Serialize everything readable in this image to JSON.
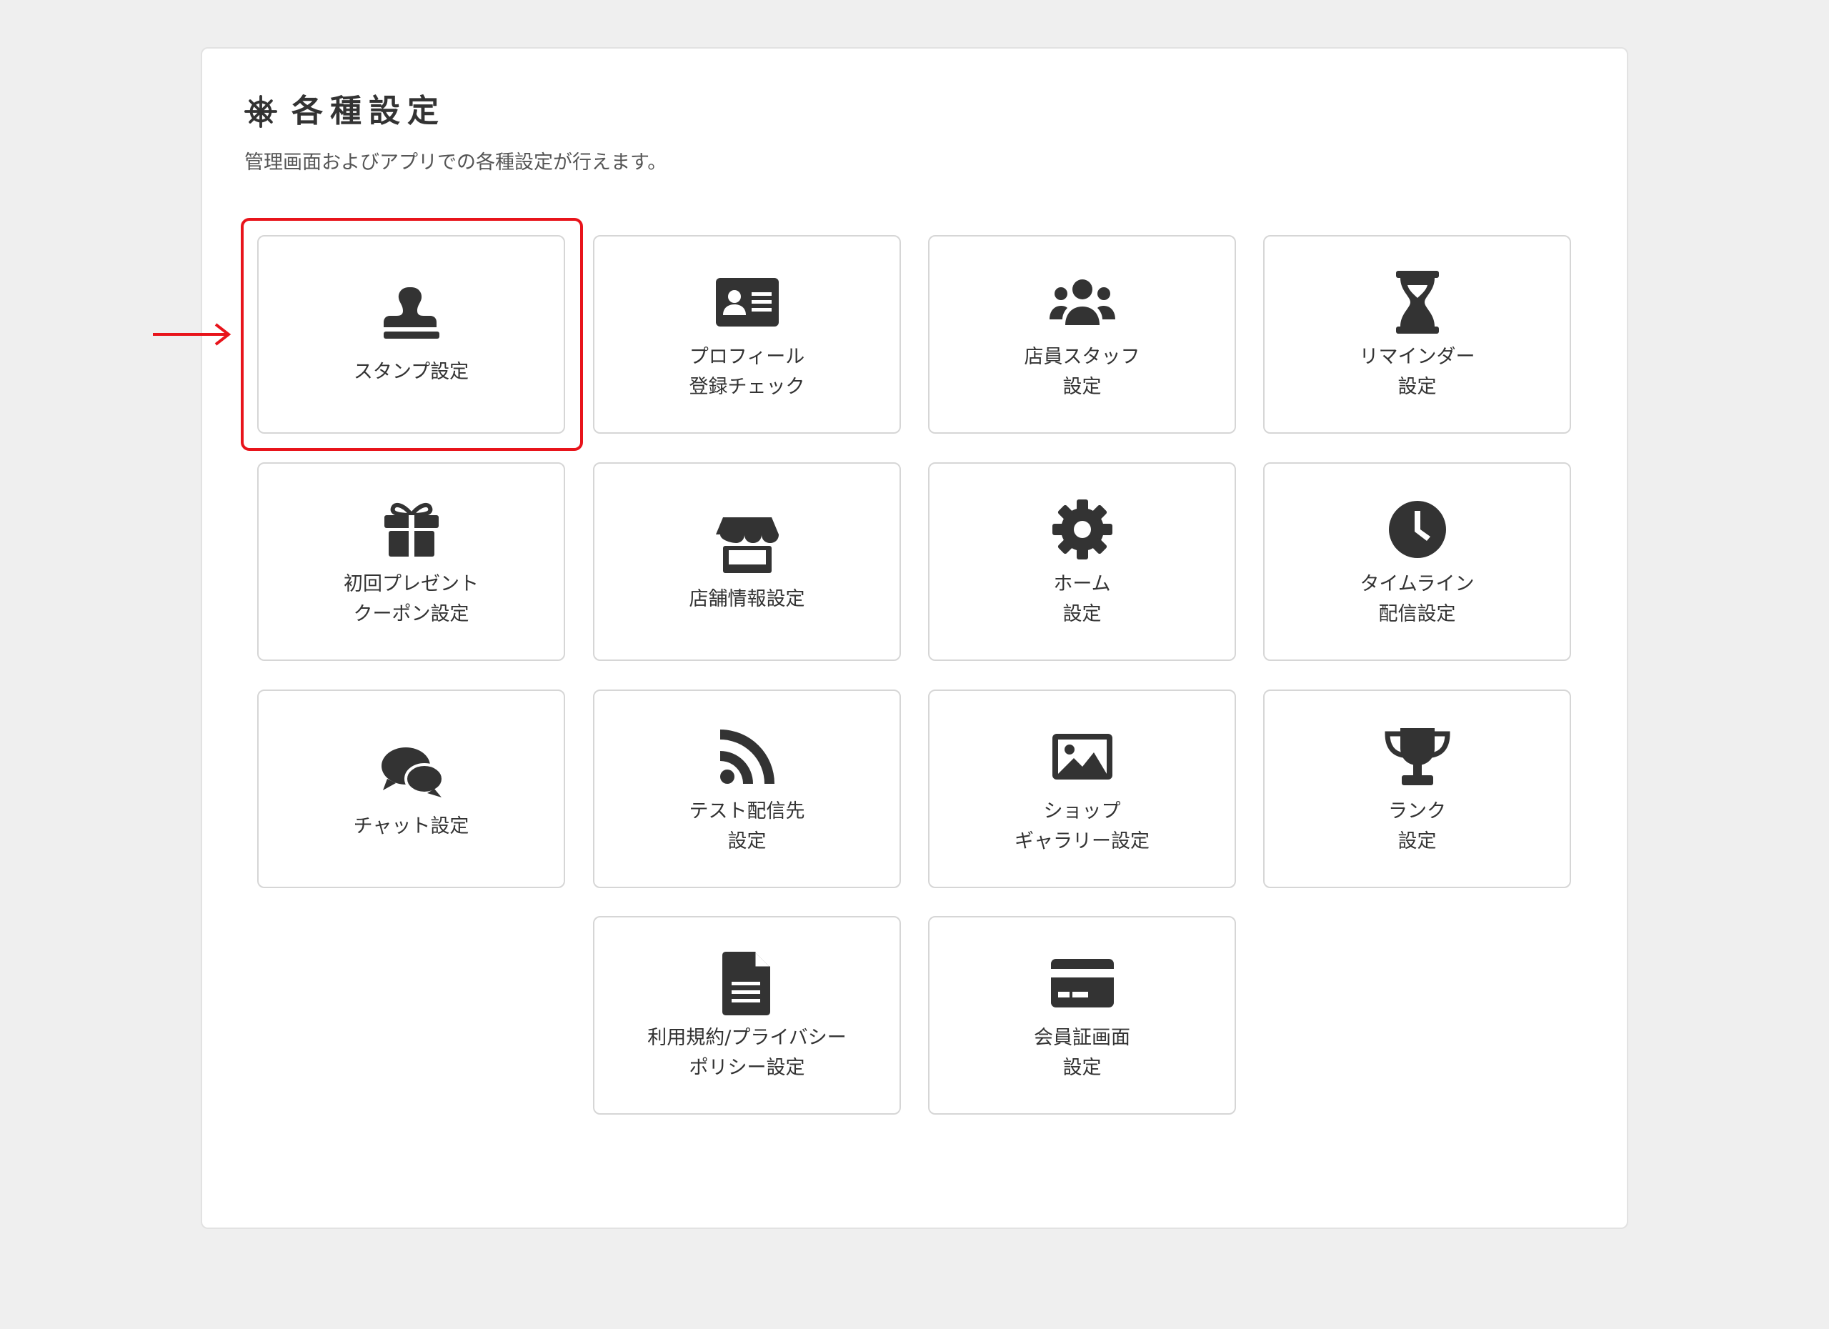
{
  "header": {
    "title": "各種設定",
    "subtitle": "管理画面およびアプリでの各種設定が行えます。"
  },
  "cards": [
    {
      "label": "スタンプ設定",
      "icon": "stamp-icon"
    },
    {
      "label": "プロフィール\n登録チェック",
      "icon": "id-card-icon"
    },
    {
      "label": "店員スタッフ\n設定",
      "icon": "users-icon"
    },
    {
      "label": "リマインダー\n設定",
      "icon": "hourglass-icon"
    },
    {
      "label": "初回プレゼント\nクーポン設定",
      "icon": "gift-icon"
    },
    {
      "label": "店舗情報設定",
      "icon": "store-icon"
    },
    {
      "label": "ホーム\n設定",
      "icon": "gear-icon"
    },
    {
      "label": "タイムライン\n配信設定",
      "icon": "clock-icon"
    },
    {
      "label": "チャット設定",
      "icon": "chat-bubbles-icon"
    },
    {
      "label": "テスト配信先\n設定",
      "icon": "rss-icon"
    },
    {
      "label": "ショップ\nギャラリー設定",
      "icon": "image-icon"
    },
    {
      "label": "ランク\n設定",
      "icon": "trophy-icon"
    },
    {
      "label": "利用規約/プライバシー\nポリシー設定",
      "icon": "document-icon"
    },
    {
      "label": "会員証画面\n設定",
      "icon": "credit-card-icon"
    }
  ],
  "colors": {
    "highlight": "#e8141b",
    "icon": "#333333"
  }
}
